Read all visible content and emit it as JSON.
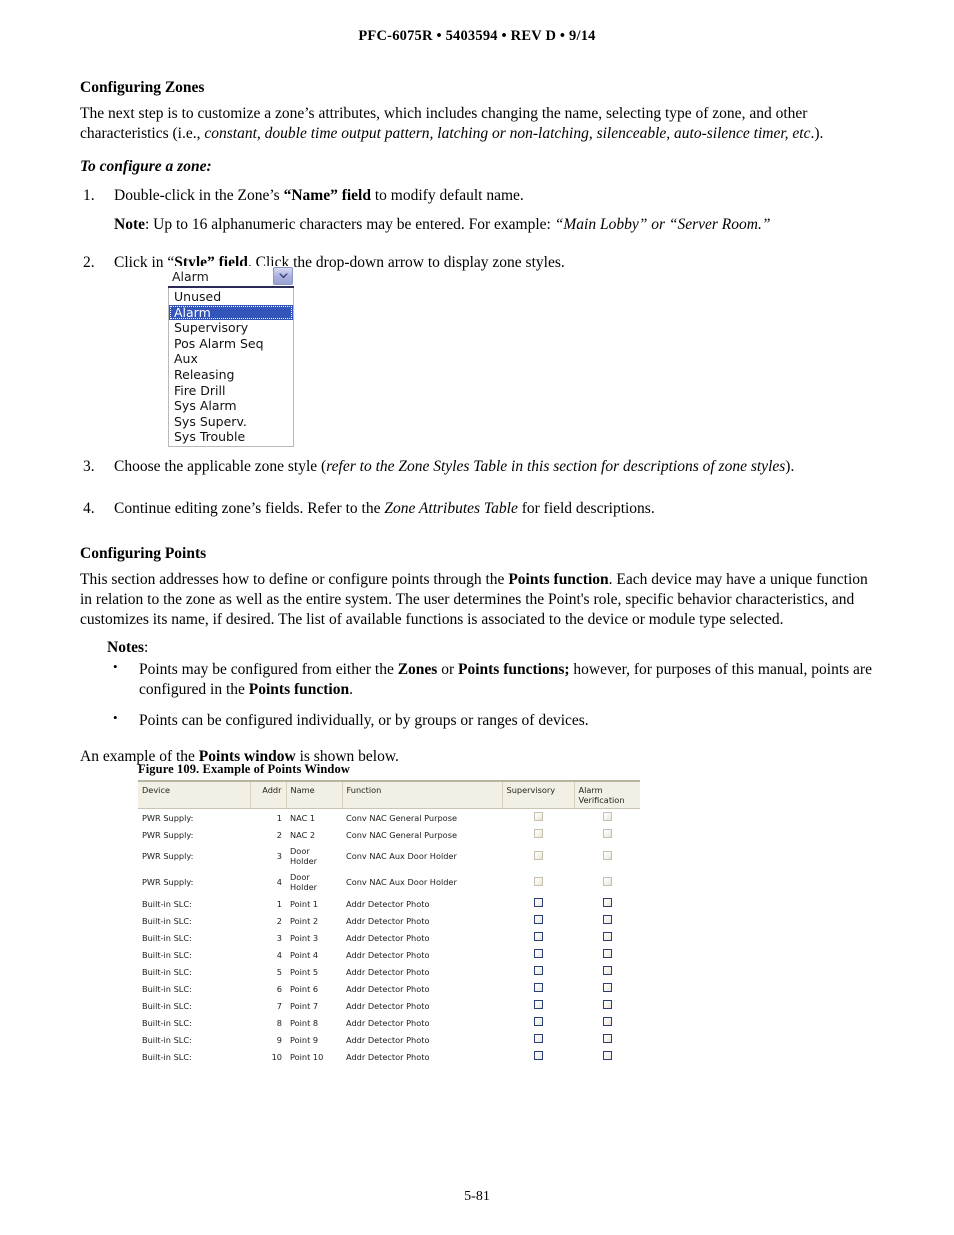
{
  "header": {
    "text": "PFC-6075R • 5403594 • REV D • 9/14"
  },
  "footer": {
    "page_number": "5-81"
  },
  "sections": {
    "zones": {
      "heading": "Configuring Zones",
      "intro_a": "The next step is to customize a zone’s attributes, which includes changing the name, selecting type of zone, and other characteristics (i.e., ",
      "intro_ital": "constant, double time output pattern, latching or non-latching, silenceable, auto-silence timer, etc",
      "intro_b": ".).",
      "subhead": "To configure a zone:",
      "steps": [
        {
          "num": "1.",
          "a": "Double-click in the Zone’s ",
          "bold": "“Name” field",
          "b": " to modify default name."
        },
        {
          "num": "2.",
          "a": "Click in “",
          "bold": "Style” field",
          "b": ". Click the drop-down arrow to display zone styles."
        },
        {
          "num": "3.",
          "a": "Choose the applicable zone style (",
          "ital": "refer to the Zone Styles Table in this section for descriptions of zone styles",
          "b": ")."
        },
        {
          "num": "4.",
          "a": "Continue editing zone’s fields. Refer to the ",
          "ital": "Zone Attributes Table",
          "b": " for field descriptions."
        }
      ],
      "note": {
        "label": "Note",
        "a": ": Up to 16 alphanumeric characters may be entered. For example: ",
        "ital": "“Main Lobby” or “Server Room.”"
      }
    },
    "style_dropdown": {
      "selected_value": "Alarm",
      "arrow_icon": "chevron-down-icon",
      "options": [
        "Unused",
        "Alarm",
        "Supervisory",
        "Pos Alarm Seq",
        "Aux",
        "Releasing",
        "Fire Drill",
        "Sys Alarm",
        "Sys Superv.",
        "Sys Trouble"
      ],
      "selected_index": 1,
      "highlight_color": "#3355bb"
    },
    "points": {
      "heading": "Configuring Points",
      "para_a": "This section addresses how to define or configure points through the ",
      "para_bold": "Points function",
      "para_b": ". Each device may have a unique function in relation to the zone as well as the entire system. The user determines the Point's role, specific behavior characteristics, and customizes its name, if desired. The list of available functions is associated to the device or module type selected.",
      "notes_label": "Notes",
      "notes_colon": ":",
      "bullets": [
        {
          "a": "Points may be configured from either the ",
          "b1": "Zones",
          "mid": " or ",
          "b2": "Points functions;",
          "c": " however, for purposes of this manual, points are configured in the ",
          "b3": "Points function",
          "d": "."
        },
        {
          "a": "Points can be configured individually, or by groups or ranges of devices.",
          "b1": "",
          "mid": "",
          "b2": "",
          "c": "",
          "b3": "",
          "d": ""
        }
      ],
      "closing_a": "An example of the ",
      "closing_bold": "Points window",
      "closing_b": " is shown below."
    }
  },
  "figure": {
    "caption": "Figure 109. Example of Points Window",
    "table": {
      "columns": [
        "Device",
        "Addr",
        "Name",
        "Function",
        "Supervisory",
        "Alarm Verification"
      ],
      "column_alarm_line1": "Alarm",
      "column_alarm_line2": "Verification",
      "rows": [
        {
          "device": "PWR Supply:",
          "addr": "1",
          "name": "NAC 1",
          "function": "Conv NAC General Purpose",
          "supervisory": "unchecked-disabled",
          "alarm_verification": "unchecked-disabled"
        },
        {
          "device": "PWR Supply:",
          "addr": "2",
          "name": "NAC 2",
          "function": "Conv NAC General Purpose",
          "supervisory": "unchecked-disabled",
          "alarm_verification": "unchecked-disabled"
        },
        {
          "device": "PWR Supply:",
          "addr": "3",
          "name": "Door Holder",
          "function": "Conv NAC Aux Door Holder",
          "supervisory": "unchecked-disabled",
          "alarm_verification": "unchecked-disabled"
        },
        {
          "device": "PWR Supply:",
          "addr": "4",
          "name": "Door Holder",
          "function": "Conv NAC Aux Door Holder",
          "supervisory": "unchecked-disabled",
          "alarm_verification": "unchecked-disabled"
        },
        {
          "device": "Built-in SLC:",
          "addr": "1",
          "name": "Point 1",
          "function": "Addr Detector Photo",
          "supervisory": "unchecked",
          "alarm_verification": "unchecked"
        },
        {
          "device": "Built-in SLC:",
          "addr": "2",
          "name": "Point 2",
          "function": "Addr Detector Photo",
          "supervisory": "unchecked",
          "alarm_verification": "unchecked"
        },
        {
          "device": "Built-in SLC:",
          "addr": "3",
          "name": "Point 3",
          "function": "Addr Detector Photo",
          "supervisory": "unchecked",
          "alarm_verification": "unchecked"
        },
        {
          "device": "Built-in SLC:",
          "addr": "4",
          "name": "Point 4",
          "function": "Addr Detector Photo",
          "supervisory": "unchecked",
          "alarm_verification": "unchecked"
        },
        {
          "device": "Built-in SLC:",
          "addr": "5",
          "name": "Point 5",
          "function": "Addr Detector Photo",
          "supervisory": "unchecked",
          "alarm_verification": "unchecked"
        },
        {
          "device": "Built-in SLC:",
          "addr": "6",
          "name": "Point 6",
          "function": "Addr Detector Photo",
          "supervisory": "unchecked",
          "alarm_verification": "unchecked"
        },
        {
          "device": "Built-in SLC:",
          "addr": "7",
          "name": "Point 7",
          "function": "Addr Detector Photo",
          "supervisory": "unchecked",
          "alarm_verification": "unchecked"
        },
        {
          "device": "Built-in SLC:",
          "addr": "8",
          "name": "Point 8",
          "function": "Addr Detector Photo",
          "supervisory": "unchecked",
          "alarm_verification": "unchecked"
        },
        {
          "device": "Built-in SLC:",
          "addr": "9",
          "name": "Point 9",
          "function": "Addr Detector Photo",
          "supervisory": "unchecked",
          "alarm_verification": "unchecked"
        },
        {
          "device": "Built-in SLC:",
          "addr": "10",
          "name": "Point 10",
          "function": "Addr Detector Photo",
          "supervisory": "unchecked",
          "alarm_verification": "unchecked"
        }
      ]
    }
  }
}
